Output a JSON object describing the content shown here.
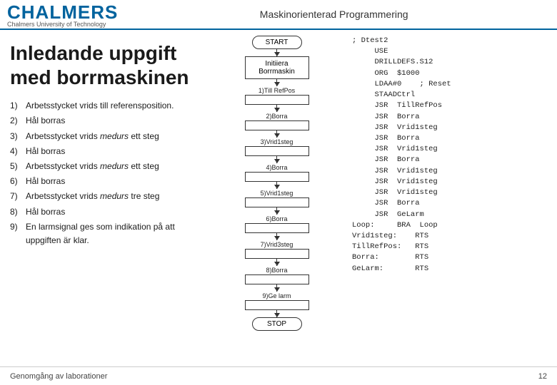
{
  "header": {
    "logo": "CHALMERS",
    "logo_sub": "Chalmers University of Technology",
    "title": "Maskinorienterad Programmering"
  },
  "slide": {
    "title_line1": "Inledande uppgift",
    "title_line2": "med borrmaskinen"
  },
  "steps": [
    {
      "num": "1)",
      "text": "Arbetsstycket vrids till referensposition."
    },
    {
      "num": "2)",
      "text": "Hål borras"
    },
    {
      "num": "3)",
      "text": "Arbetsstycket vrids ",
      "italic": "medurs",
      "text2": " ett steg"
    },
    {
      "num": "4)",
      "text": "Hål borras"
    },
    {
      "num": "5)",
      "text": "Arbetsstycket vrids ",
      "italic": "medurs",
      "text2": " ett steg"
    },
    {
      "num": "6)",
      "text": "Hål borras"
    },
    {
      "num": "7)",
      "text": "Arbetsstycket vrids ",
      "italic": "medurs",
      "text2": " tre steg"
    },
    {
      "num": "8)",
      "text": "Hål borras"
    },
    {
      "num": "9)",
      "text_line1": "En larmsignal ges som indikation på att",
      "text_line2": "uppgiften är klar."
    }
  ],
  "flowchart": {
    "nodes": [
      {
        "type": "oval",
        "label": "START"
      },
      {
        "type": "rect2",
        "label": "Initiiera\nBorrmaskin"
      },
      {
        "type": "label",
        "label": "1)Till RefPos"
      },
      {
        "type": "rect",
        "label": ""
      },
      {
        "type": "label",
        "label": "2)Borra"
      },
      {
        "type": "rect",
        "label": ""
      },
      {
        "type": "label",
        "label": "3)Vrid1steg"
      },
      {
        "type": "rect",
        "label": ""
      },
      {
        "type": "label",
        "label": "4)Borra"
      },
      {
        "type": "rect",
        "label": ""
      },
      {
        "type": "label",
        "label": "5)Vrid1steg"
      },
      {
        "type": "rect",
        "label": ""
      },
      {
        "type": "label",
        "label": "6)Borra"
      },
      {
        "type": "rect",
        "label": ""
      },
      {
        "type": "label",
        "label": "7)Vrid3steg"
      },
      {
        "type": "rect",
        "label": ""
      },
      {
        "type": "label",
        "label": "8)Borra"
      },
      {
        "type": "rect",
        "label": ""
      },
      {
        "type": "label",
        "label": "9)Ge larm"
      },
      {
        "type": "rect",
        "label": ""
      },
      {
        "type": "oval",
        "label": "STOP"
      }
    ]
  },
  "code": {
    "lines": [
      "; Dtest2",
      "     USE",
      "     DRILLDEFS.S12",
      "     ORG  $1000",
      "     LDAA#0    ; Reset",
      "     STAADCtrl",
      "     JSR  TillRefPos",
      "     JSR  Borra",
      "     JSR  Vrid1steg",
      "     JSR  Borra",
      "     JSR  Vrid1steg",
      "     JSR  Borra",
      "     JSR  Vrid1steg",
      "     JSR  Vrid1steg",
      "     JSR  Vrid1steg",
      "     JSR  Borra",
      "     JSR  GeLarm",
      "Loop:     BRA  Loop",
      "Vrid1steg:    RTS",
      "TillRefPos:   RTS",
      "Borra:        RTS",
      "GeLarm:       RTS"
    ]
  },
  "footer": {
    "left": "Genomgång av laborationer",
    "right": "12"
  }
}
